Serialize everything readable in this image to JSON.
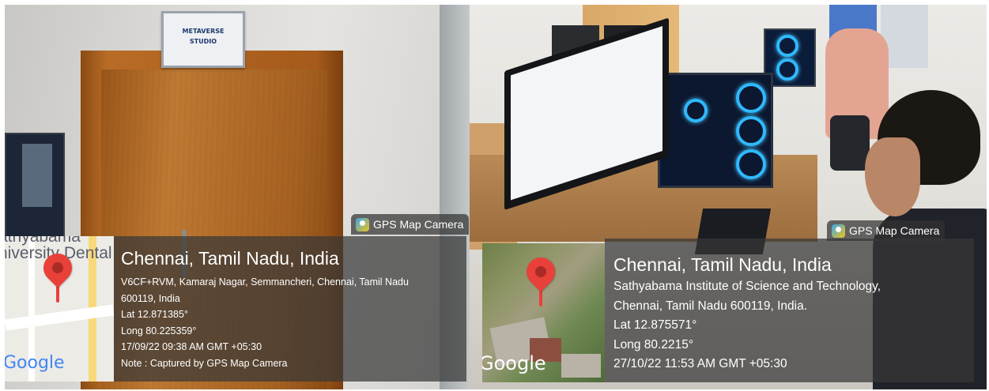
{
  "left_photo": {
    "sign": {
      "line1": "METAVERSE",
      "line2": "STUDIO"
    },
    "gps_tag": "GPS Map Camera",
    "map": {
      "label": "athyabama niversity Dental",
      "logo": "Google",
      "pin_icon": "map-pin-icon"
    },
    "info": {
      "city": "Chennai, Tamil Nadu, India",
      "address_line1": "V6CF+RVM, Kamaraj Nagar, Semmancheri, Chennai, Tamil Nadu",
      "address_line2": "600119, India",
      "lat": "Lat 12.871385°",
      "long": "Long 80.225359°",
      "datetime": "17/09/22 09:38 AM GMT +05:30",
      "note": "Note : Captured by GPS Map Camera"
    }
  },
  "right_photo": {
    "gps_tag": "GPS Map Camera",
    "map": {
      "logo": "Google",
      "pin_icon": "map-pin-icon"
    },
    "info": {
      "city": "Chennai, Tamil Nadu, India",
      "address_line1": "Sathyabama Institute of Science and Technology,",
      "address_line2": "Chennai, Tamil Nadu 600119, India.",
      "lat": "Lat 12.875571°",
      "long": "Long 80.2215°",
      "datetime": "27/10/22 11:53 AM GMT +05:30"
    }
  },
  "colors": {
    "overlay": "#373737",
    "pin": "#e8413a",
    "google_blue": "#4285f4",
    "google_red": "#ea4335",
    "google_yellow": "#fbbc05",
    "google_green": "#34a853"
  }
}
